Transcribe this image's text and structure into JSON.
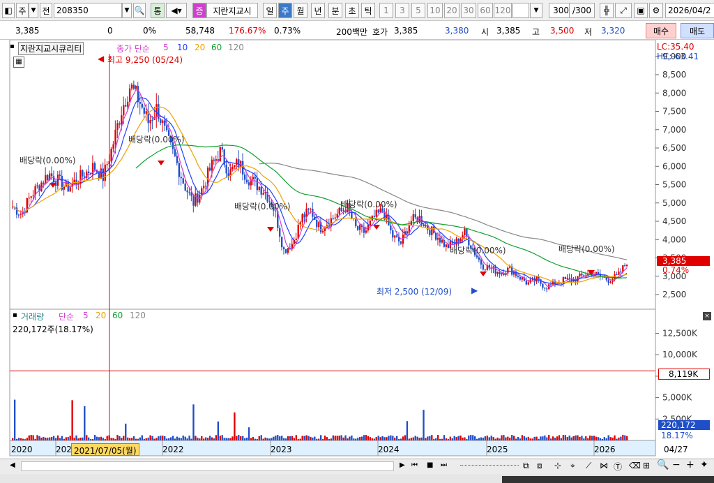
{
  "toolbar": {
    "market": "주",
    "kind": "전",
    "code": "208350",
    "tong": "통",
    "jeung": "증",
    "stock_name": "지란지교시",
    "periods": [
      "일",
      "주",
      "월",
      "년",
      "분",
      "초",
      "틱"
    ],
    "intervals": [
      "1",
      "3",
      "5",
      "10",
      "20",
      "30",
      "60",
      "120"
    ],
    "count": "300",
    "count_max": "/300",
    "date": "2026/04/2"
  },
  "quote": {
    "price": "3,385",
    "change": "0",
    "change_pct": "0%",
    "volume": "58,748",
    "vol_ratio": "176.67%",
    "turnover": "0.73%",
    "amount": "200백만",
    "bid_label": "호가",
    "bid": "3,385",
    "ask": "3,380",
    "open_label": "시",
    "open": "3,385",
    "high_label": "고",
    "high": "3,500",
    "low_label": "저",
    "low": "3,320",
    "buy": "매수",
    "sell": "매도"
  },
  "price_panel": {
    "name": "지란지교시큐리티",
    "ma_label": "종가 단순",
    "ma_periods": [
      "5",
      "10",
      "20",
      "60",
      "120"
    ],
    "lc": "LC:35.40",
    "hc": "HC:-63.41",
    "max_note": "최고 9,250 (05/24)",
    "min_note": "최저 2,500 (12/09)",
    "div_label": "배당락(0.00%)",
    "current_price": "3,385",
    "current_pct": "0.74%"
  },
  "volume_panel": {
    "name": "거래량",
    "ma_label": "단순",
    "ma_periods": [
      "5",
      "20",
      "60",
      "120"
    ],
    "current": "220,172주(18.17%)",
    "line_value": "8,119K",
    "current_badge": "220,172",
    "current_pct": "18.17%"
  },
  "x_axis": {
    "labels": [
      "2020",
      "2021",
      "2022",
      "2023",
      "2024",
      "2025",
      "2026"
    ],
    "cursor_date": "2021/07/05(월)",
    "end_label": "04/27"
  },
  "chart_data": {
    "type": "candlestick",
    "y_ticks": [
      "9,000",
      "8,500",
      "8,000",
      "7,500",
      "7,000",
      "6,500",
      "6,000",
      "5,500",
      "5,000",
      "4,500",
      "4,000",
      "3,500",
      "3,000",
      "2,500"
    ],
    "ylim": [
      2100,
      9300
    ],
    "volume_ticks": [
      "12,500K",
      "10,000K",
      "7,500K",
      "5,000K",
      "2,500K"
    ],
    "volume_ylim": [
      0,
      14500
    ],
    "weekly_close_approx": [
      4900,
      4700,
      5200,
      5500,
      5800,
      5600,
      5400,
      5600,
      5800,
      6000,
      5700,
      6500,
      7500,
      8200,
      7800,
      7200,
      7600,
      6800,
      6200,
      5500,
      5000,
      5400,
      6000,
      6400,
      5800,
      6100,
      5700,
      5500,
      5300,
      4800,
      3700,
      3900,
      4600,
      4800,
      4300,
      4500,
      4700,
      4900,
      4300,
      4200,
      4600,
      4800,
      4100,
      3900,
      4500,
      4600,
      4300,
      4100,
      3800,
      3900,
      4200,
      3700,
      3300,
      3200,
      3100,
      3200,
      3000,
      2800,
      2900,
      2700,
      2800,
      2900,
      2900,
      3000,
      3100,
      3000,
      2900,
      3000,
      3400
    ]
  }
}
